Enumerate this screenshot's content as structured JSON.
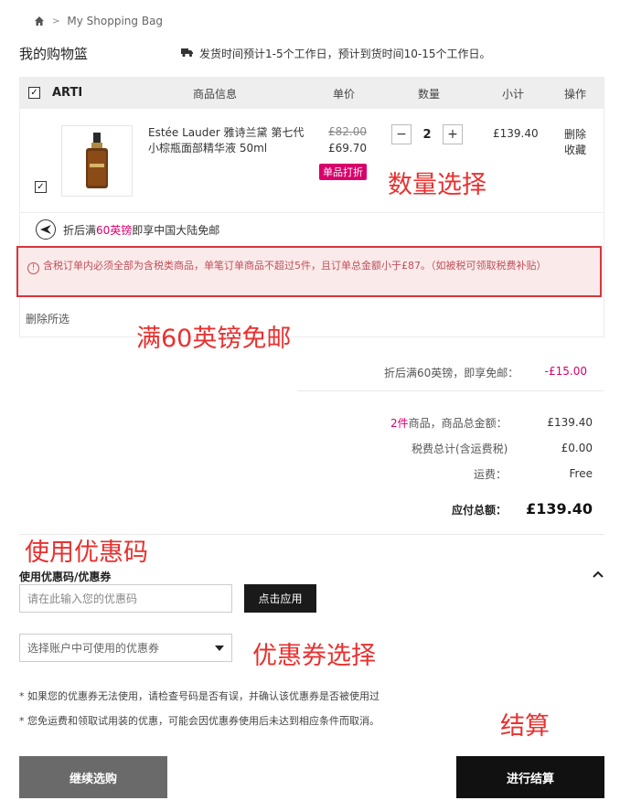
{
  "breadcrumb": {
    "current": "My Shopping Bag"
  },
  "page_title": "我的购物篮",
  "shipping_note": "发货时间预计1-5个工作日，预计到货时间10-15个工作日。",
  "cart": {
    "brand": "ARTI",
    "columns": {
      "product": "商品信息",
      "unit_price": "单价",
      "quantity": "数量",
      "subtotal": "小计",
      "actions": "操作"
    },
    "item": {
      "name": "Estée Lauder 雅诗兰黛 第七代小棕瓶面部精华液 50ml",
      "price_original": "£82.00",
      "price_current": "£69.70",
      "discount_tag": "单品打折",
      "quantity": "2",
      "subtotal": "£139.40",
      "action_delete": "删除",
      "action_favorite": "收藏"
    },
    "free_shipping_prefix": "折后满",
    "free_shipping_highlight": "60英镑",
    "free_shipping_suffix": "即享中国大陆免邮",
    "tax_warning": "含税订单内必须全部为含税类商品，单笔订单商品不超过5件，且订单总金额小于£87。（如被税可领取税费补贴）",
    "delete_selected": "删除所选"
  },
  "annotations": {
    "quantity_select": "数量选择",
    "free_shipping": "满60英镑免邮",
    "use_coupon": "使用优惠码",
    "coupon_select": "优惠券选择",
    "checkout": "结算"
  },
  "summary": {
    "discount_label": "折后满60英镑，即享免邮：",
    "discount_value": "-£15.00",
    "items_count": "2件",
    "items_label": "商品，商品总金额：",
    "items_value": "£139.40",
    "tax_label": "税费总计(含运费税)",
    "tax_value": "£0.00",
    "shipping_label": "运费：",
    "shipping_value": "Free",
    "total_label": "应付总额：",
    "total_value": "£139.40"
  },
  "coupon": {
    "label": "使用优惠码/优惠券",
    "input_placeholder": "请在此输入您的优惠码",
    "apply_label": "点击应用",
    "select_placeholder": "选择账户中可使用的优惠券",
    "note1": "* 如果您的优惠券无法使用，请检查号码是否有误，并确认该优惠券是否被使用过",
    "note2": "* 您免运费和领取试用装的优惠，可能会因优惠券使用后未达到相应条件而取消。"
  },
  "buttons": {
    "continue": "继续选购",
    "checkout": "进行结算"
  },
  "colors": {
    "accent": "#d8006b",
    "annotation": "#e8312f",
    "warning_border": "#d8343c"
  }
}
